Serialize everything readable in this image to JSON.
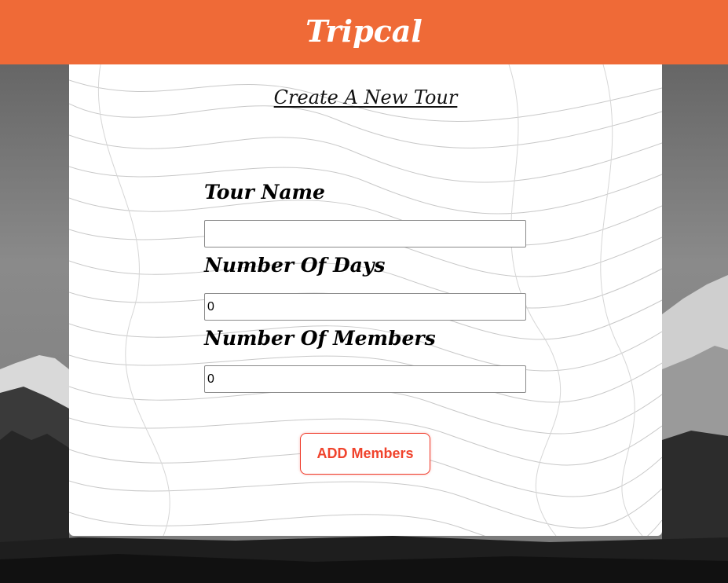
{
  "header": {
    "brand": "Tripcal",
    "background_color": "#ef6a37"
  },
  "form": {
    "title": "Create A New Tour",
    "fields": [
      {
        "label": "Tour Name",
        "value": ""
      },
      {
        "label": "Number Of Days",
        "value": "0"
      },
      {
        "label": "Number Of Members",
        "value": "0"
      }
    ],
    "add_button_label": "ADD Members",
    "accent_color": "#f0432c"
  }
}
